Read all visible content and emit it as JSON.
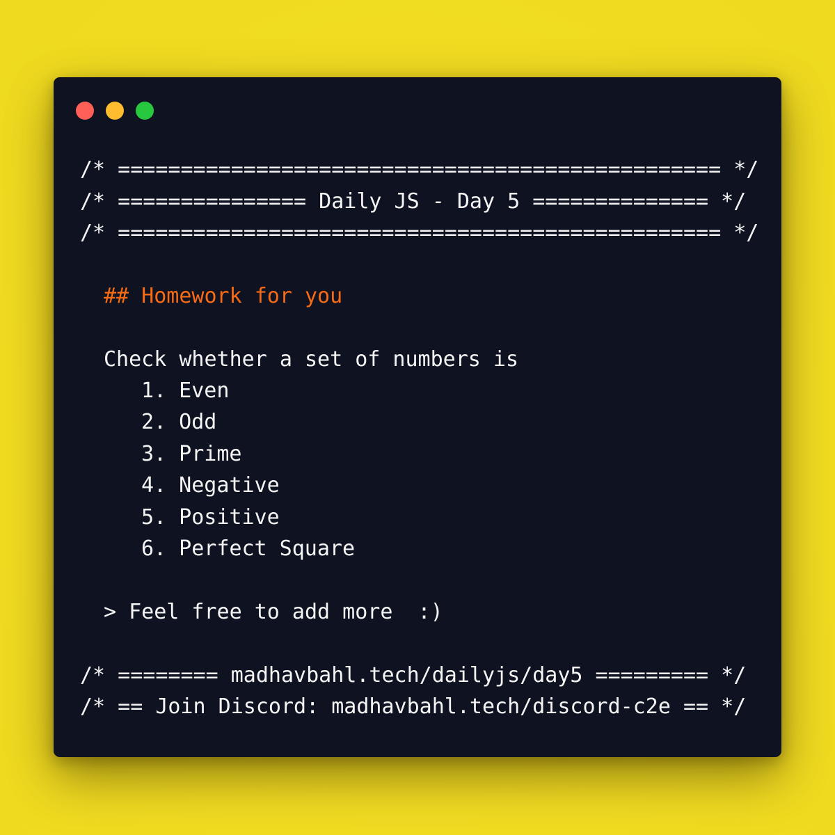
{
  "window": {
    "controls": [
      "close",
      "minimize",
      "maximize"
    ],
    "colors": {
      "background": "#0f1221",
      "text": "#f4f4f4",
      "heading": "#f76b15",
      "close": "#fe5f57",
      "minimize": "#febc2e",
      "maximize": "#27c840",
      "page_background": "#f1dc22"
    }
  },
  "code": {
    "banner_top": "/* ================================================ */",
    "banner_title": "/* =============== Daily JS - Day 5 ============== */",
    "banner_bottom": "/* ================================================ */",
    "heading": "## Homework for you",
    "intro": "Check whether a set of numbers is",
    "items": [
      "1. Even",
      "2. Odd",
      "3. Prime",
      "4. Negative",
      "5. Positive",
      "6. Perfect Square"
    ],
    "note": "> Feel free to add more  :)",
    "footer_link": "/* ======== madhavbahl.tech/dailyjs/day5 ========= */",
    "footer_discord": "/* == Join Discord: madhavbahl.tech/discord-c2e == */"
  }
}
